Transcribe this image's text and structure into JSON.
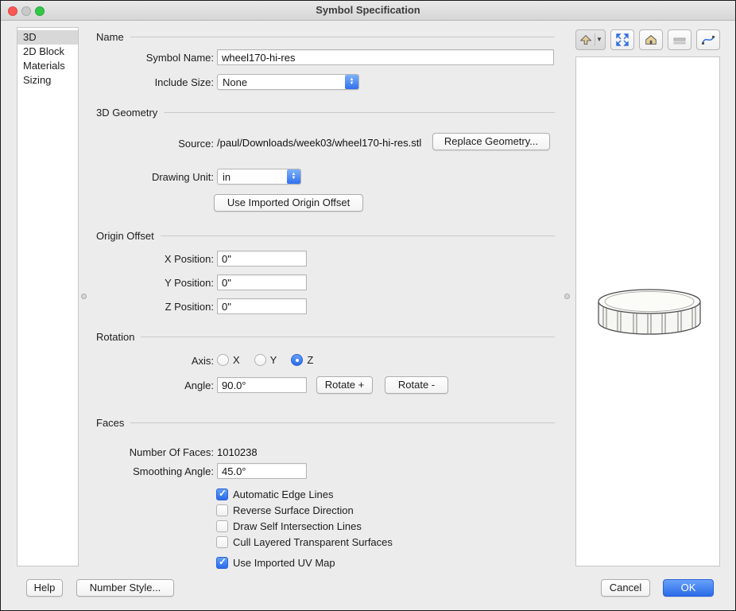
{
  "window": {
    "title": "Symbol Specification"
  },
  "sidebar": {
    "items": [
      {
        "label": "3D",
        "selected": true
      },
      {
        "label": "2D Block",
        "selected": false
      },
      {
        "label": "Materials",
        "selected": false
      },
      {
        "label": "Sizing",
        "selected": false
      }
    ]
  },
  "sections": {
    "name": {
      "header": "Name",
      "symbol_name_label": "Symbol Name:",
      "symbol_name_value": "wheel170-hi-res",
      "include_size_label": "Include Size:",
      "include_size_value": "None"
    },
    "geometry": {
      "header": "3D Geometry",
      "source_label": "Source:",
      "source_value": "/paul/Downloads/week03/wheel170-hi-res.stl",
      "replace_button": "Replace Geometry...",
      "drawing_unit_label": "Drawing Unit:",
      "drawing_unit_value": "in",
      "use_imported_button": "Use Imported Origin Offset"
    },
    "origin_offset": {
      "header": "Origin Offset",
      "x_label": "X Position:",
      "x_value": "0\"",
      "y_label": "Y Position:",
      "y_value": "0\"",
      "z_label": "Z Position:",
      "z_value": "0\""
    },
    "rotation": {
      "header": "Rotation",
      "axis_label": "Axis:",
      "axes": [
        {
          "label": "X",
          "selected": false
        },
        {
          "label": "Y",
          "selected": false
        },
        {
          "label": "Z",
          "selected": true
        }
      ],
      "angle_label": "Angle:",
      "angle_value": "90.0°",
      "rotate_plus_button": "Rotate +",
      "rotate_minus_button": "Rotate -"
    },
    "faces": {
      "header": "Faces",
      "num_faces_label": "Number Of Faces:",
      "num_faces_value": "1010238",
      "smoothing_label": "Smoothing Angle:",
      "smoothing_value": "45.0°",
      "checkboxes": [
        {
          "label": "Automatic Edge Lines",
          "checked": true
        },
        {
          "label": "Reverse Surface Direction",
          "checked": false
        },
        {
          "label": "Draw Self Intersection Lines",
          "checked": false
        },
        {
          "label": "Cull Layered Transparent Surfaces",
          "checked": false
        },
        {
          "label": "Use Imported UV Map",
          "checked": true
        }
      ]
    }
  },
  "preview": {
    "toolbar_icons": [
      "view-mode",
      "fit-to-view",
      "front-view",
      "section-view",
      "render-style"
    ]
  },
  "footer": {
    "help_button": "Help",
    "number_style_button": "Number Style...",
    "cancel_button": "Cancel",
    "ok_button": "OK"
  },
  "colors": {
    "accent_blue": "#3478f6",
    "selected_row": "#d8d8d8"
  }
}
